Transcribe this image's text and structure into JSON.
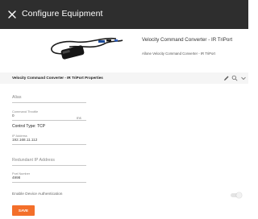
{
  "window": {
    "title": "Configure Equipment"
  },
  "product": {
    "name": "Velocity Command Converter - IR TriPort",
    "subtitle": "Allone Velocity Command Converter - IR TriPort"
  },
  "properties": {
    "title": "Velocity Command Converter - IR TriPort Properties",
    "icons": [
      "pencil-icon",
      "search-icon",
      "chevron-down-icon"
    ]
  },
  "form": {
    "alias": {
      "placeholder": "Alias",
      "value": ""
    },
    "command_throttle": {
      "label": "Command Throttle",
      "value": "0",
      "unit": "ms"
    },
    "control_type": "Control Type: TCP",
    "ip_address": {
      "label": "IP Address",
      "value": "192.168.11.112"
    },
    "redundant_ip": {
      "placeholder": "Redundant IP Address",
      "value": ""
    },
    "port_number": {
      "label": "Port Number",
      "value": "4998"
    },
    "enable_device_auth": {
      "label": "Enable Device Authentication",
      "enabled": false
    },
    "save_label": "SAVE"
  },
  "colors": {
    "titlebar": "#2e2e2e",
    "accent": "#f36f2a"
  }
}
